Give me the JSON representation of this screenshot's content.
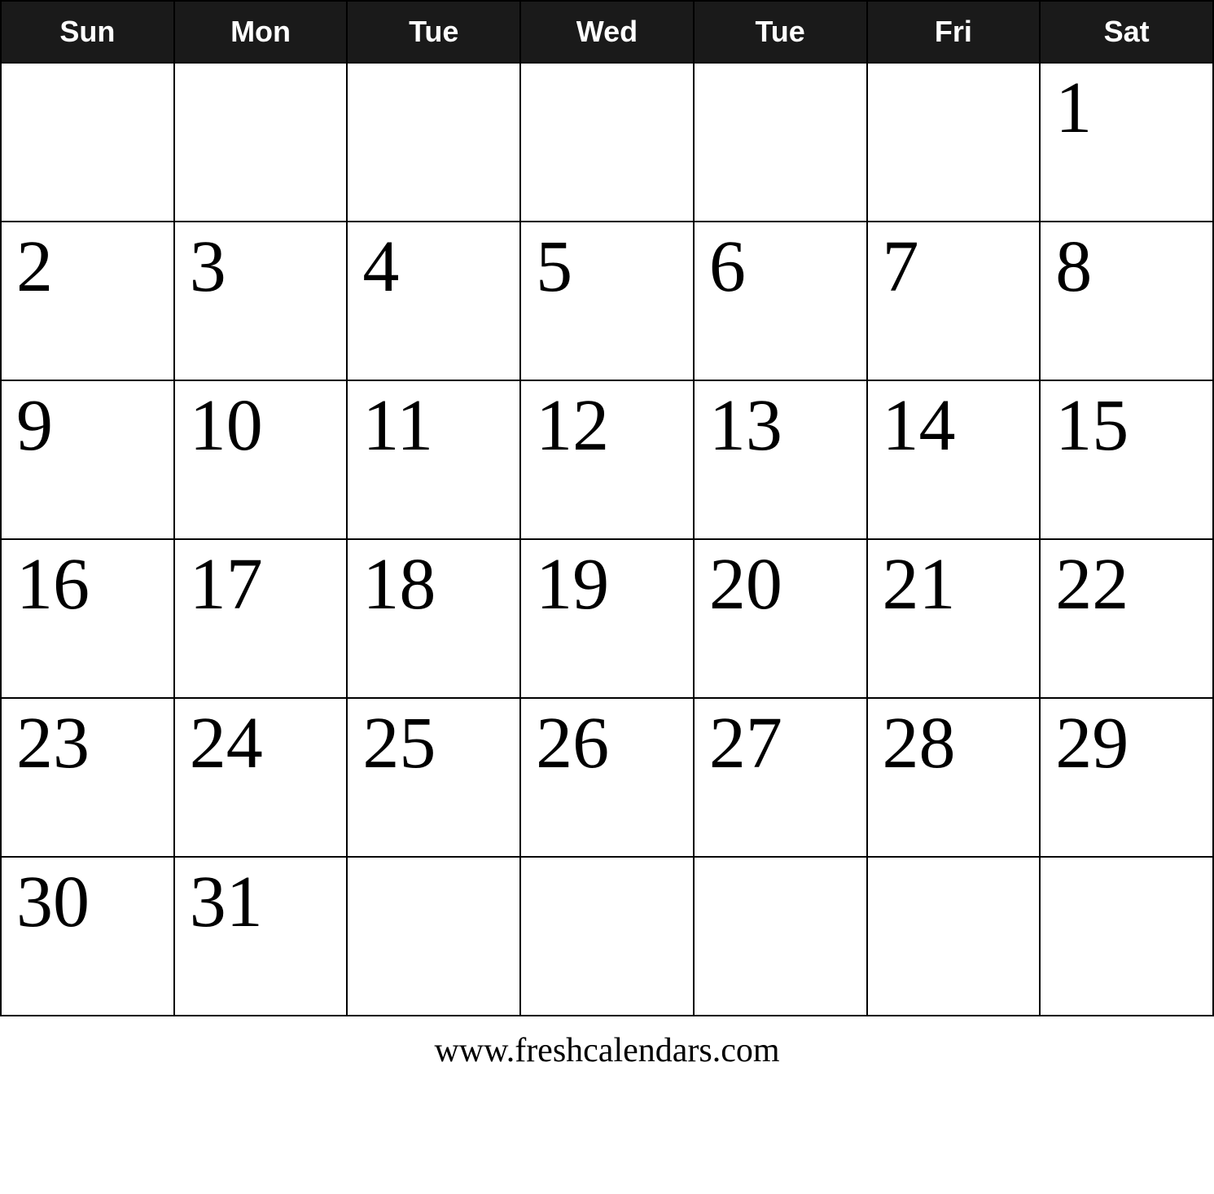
{
  "calendar": {
    "headers": [
      "Sun",
      "Mon",
      "Tue",
      "Wed",
      "Tue",
      "Fri",
      "Sat"
    ],
    "weeks": [
      [
        {
          "day": "",
          "empty": true
        },
        {
          "day": "",
          "empty": true
        },
        {
          "day": "",
          "empty": true
        },
        {
          "day": "",
          "empty": true
        },
        {
          "day": "",
          "empty": true
        },
        {
          "day": "",
          "empty": true
        },
        {
          "day": "1",
          "empty": false
        }
      ],
      [
        {
          "day": "2",
          "empty": false
        },
        {
          "day": "3",
          "empty": false
        },
        {
          "day": "4",
          "empty": false
        },
        {
          "day": "5",
          "empty": false
        },
        {
          "day": "6",
          "empty": false
        },
        {
          "day": "7",
          "empty": false
        },
        {
          "day": "8",
          "empty": false
        }
      ],
      [
        {
          "day": "9",
          "empty": false
        },
        {
          "day": "10",
          "empty": false
        },
        {
          "day": "11",
          "empty": false
        },
        {
          "day": "12",
          "empty": false
        },
        {
          "day": "13",
          "empty": false
        },
        {
          "day": "14",
          "empty": false
        },
        {
          "day": "15",
          "empty": false
        }
      ],
      [
        {
          "day": "16",
          "empty": false
        },
        {
          "day": "17",
          "empty": false
        },
        {
          "day": "18",
          "empty": false
        },
        {
          "day": "19",
          "empty": false
        },
        {
          "day": "20",
          "empty": false
        },
        {
          "day": "21",
          "empty": false
        },
        {
          "day": "22",
          "empty": false
        }
      ],
      [
        {
          "day": "23",
          "empty": false
        },
        {
          "day": "24",
          "empty": false
        },
        {
          "day": "25",
          "empty": false
        },
        {
          "day": "26",
          "empty": false
        },
        {
          "day": "27",
          "empty": false
        },
        {
          "day": "28",
          "empty": false
        },
        {
          "day": "29",
          "empty": false
        }
      ],
      [
        {
          "day": "30",
          "empty": false
        },
        {
          "day": "31",
          "empty": false
        },
        {
          "day": "",
          "empty": true
        },
        {
          "day": "",
          "empty": true
        },
        {
          "day": "",
          "empty": true
        },
        {
          "day": "",
          "empty": true
        },
        {
          "day": "",
          "empty": true
        }
      ]
    ],
    "footer": "www.freshcalendars.com"
  }
}
